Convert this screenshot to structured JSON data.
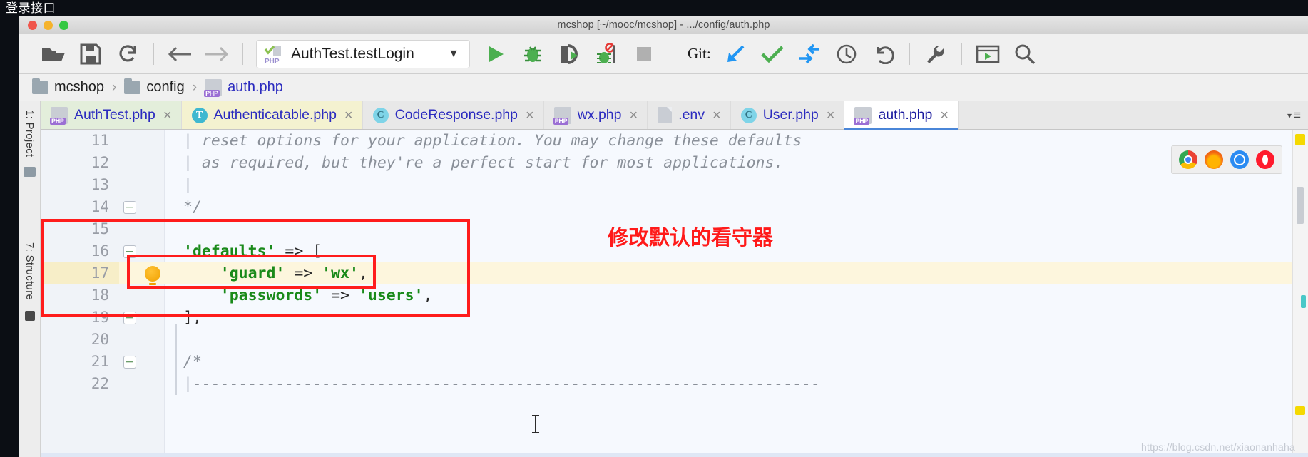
{
  "page": {
    "caption": "登录接口"
  },
  "window": {
    "title": "mcshop [~/mooc/mcshop] - .../config/auth.php",
    "traffic": {
      "close": "close-button",
      "minimize": "minimize-button",
      "zoom": "zoom-button"
    }
  },
  "toolbar": {
    "open_label": "open-folder",
    "save_label": "save-all",
    "sync_label": "synchronize",
    "back_label": "back",
    "forward_label": "forward",
    "run_config": {
      "name": "AuthTest.testLogin",
      "badge": "PHP",
      "dropdown": "▾"
    },
    "run_label": "run",
    "debug_label": "debug",
    "run_coverage_label": "run-with-coverage",
    "stop_debug_label": "stop-debug",
    "stop_label": "stop",
    "git_label": "Git:",
    "git_update_label": "update-project",
    "git_commit_label": "commit",
    "git_push_label": "push",
    "git_history_label": "history",
    "git_revert_label": "revert",
    "settings_label": "settings",
    "preview_label": "preview",
    "search_label": "search-everywhere"
  },
  "breadcrumb": {
    "items": [
      {
        "label": "mcshop",
        "icon": "folder-icon",
        "type": "folder"
      },
      {
        "label": "config",
        "icon": "folder-icon",
        "type": "folder"
      },
      {
        "label": "auth.php",
        "icon": "php-file-icon",
        "type": "file"
      }
    ],
    "separator": "›"
  },
  "left_rail": {
    "items": [
      {
        "label": "1: Project"
      },
      {
        "label": "7: Structure"
      }
    ]
  },
  "tabs": {
    "items": [
      {
        "label": "AuthTest.php",
        "icon": "php-file-icon",
        "style": "green",
        "active": false,
        "close": "×"
      },
      {
        "label": "Authenticatable.php",
        "icon": "trait-icon",
        "style": "yellow",
        "active": false,
        "close": "×"
      },
      {
        "label": "CodeResponse.php",
        "icon": "class-icon",
        "style": "plain",
        "active": false,
        "close": "×"
      },
      {
        "label": "wx.php",
        "icon": "php-file-icon",
        "style": "plain",
        "active": false,
        "close": "×"
      },
      {
        "label": ".env",
        "icon": "file-icon",
        "style": "plain",
        "active": false,
        "close": "×"
      },
      {
        "label": "User.php",
        "icon": "class-icon",
        "style": "plain",
        "active": false,
        "close": "×"
      },
      {
        "label": "auth.php",
        "icon": "php-file-icon",
        "style": "plain",
        "active": true,
        "close": "×"
      }
    ],
    "overflow_menu": "≡"
  },
  "editor": {
    "lines": [
      {
        "num": "11",
        "segments": [
          {
            "t": "pipe",
            "v": "|"
          },
          {
            "t": "cm",
            "v": " reset options for your application. You may change these defaults"
          }
        ],
        "highlight": false
      },
      {
        "num": "12",
        "segments": [
          {
            "t": "pipe",
            "v": "|"
          },
          {
            "t": "cm",
            "v": " as required, but they're a perfect start for most applications."
          }
        ],
        "highlight": false
      },
      {
        "num": "13",
        "segments": [
          {
            "t": "pipe",
            "v": "|"
          }
        ],
        "highlight": false
      },
      {
        "num": "14",
        "segments": [
          {
            "t": "cm",
            "v": "*/"
          }
        ],
        "highlight": false,
        "fold": true
      },
      {
        "num": "15",
        "segments": [],
        "highlight": false
      },
      {
        "num": "16",
        "segments": [
          {
            "t": "str",
            "v": "'defaults'"
          },
          {
            "t": "op",
            "v": " => ["
          }
        ],
        "highlight": false,
        "fold": true
      },
      {
        "num": "17",
        "segments": [
          {
            "t": "op",
            "v": "    "
          },
          {
            "t": "str",
            "v": "'guard'"
          },
          {
            "t": "op",
            "v": " => "
          },
          {
            "t": "str",
            "v": "'wx'"
          },
          {
            "t": "op",
            "v": ","
          }
        ],
        "highlight": true,
        "bulb": true
      },
      {
        "num": "18",
        "segments": [
          {
            "t": "op",
            "v": "    "
          },
          {
            "t": "str",
            "v": "'passwords'"
          },
          {
            "t": "op",
            "v": " => "
          },
          {
            "t": "str",
            "v": "'users'"
          },
          {
            "t": "op",
            "v": ","
          }
        ],
        "highlight": false
      },
      {
        "num": "19",
        "segments": [
          {
            "t": "op",
            "v": "],"
          }
        ],
        "highlight": false,
        "fold": true
      },
      {
        "num": "20",
        "segments": [],
        "highlight": false
      },
      {
        "num": "21",
        "segments": [
          {
            "t": "cm",
            "v": "/*"
          }
        ],
        "highlight": false,
        "fold": true
      },
      {
        "num": "22",
        "segments": [
          {
            "t": "pipe",
            "v": "|"
          },
          {
            "t": "cm",
            "v": "--------------------------------------------------------------------"
          }
        ],
        "highlight": false
      }
    ]
  },
  "annotations": {
    "note_text": "修改默认的看守器",
    "note_color": "#ff1a1a",
    "outer_box": "defaults-block-highlight",
    "inner_box": "guard-line-highlight"
  },
  "browsers": {
    "items": [
      {
        "name": "chrome-icon"
      },
      {
        "name": "firefox-icon"
      },
      {
        "name": "safari-icon"
      },
      {
        "name": "opera-icon"
      }
    ]
  },
  "watermark": {
    "text": "https://blog.csdn.net/xiaonanhaha"
  }
}
